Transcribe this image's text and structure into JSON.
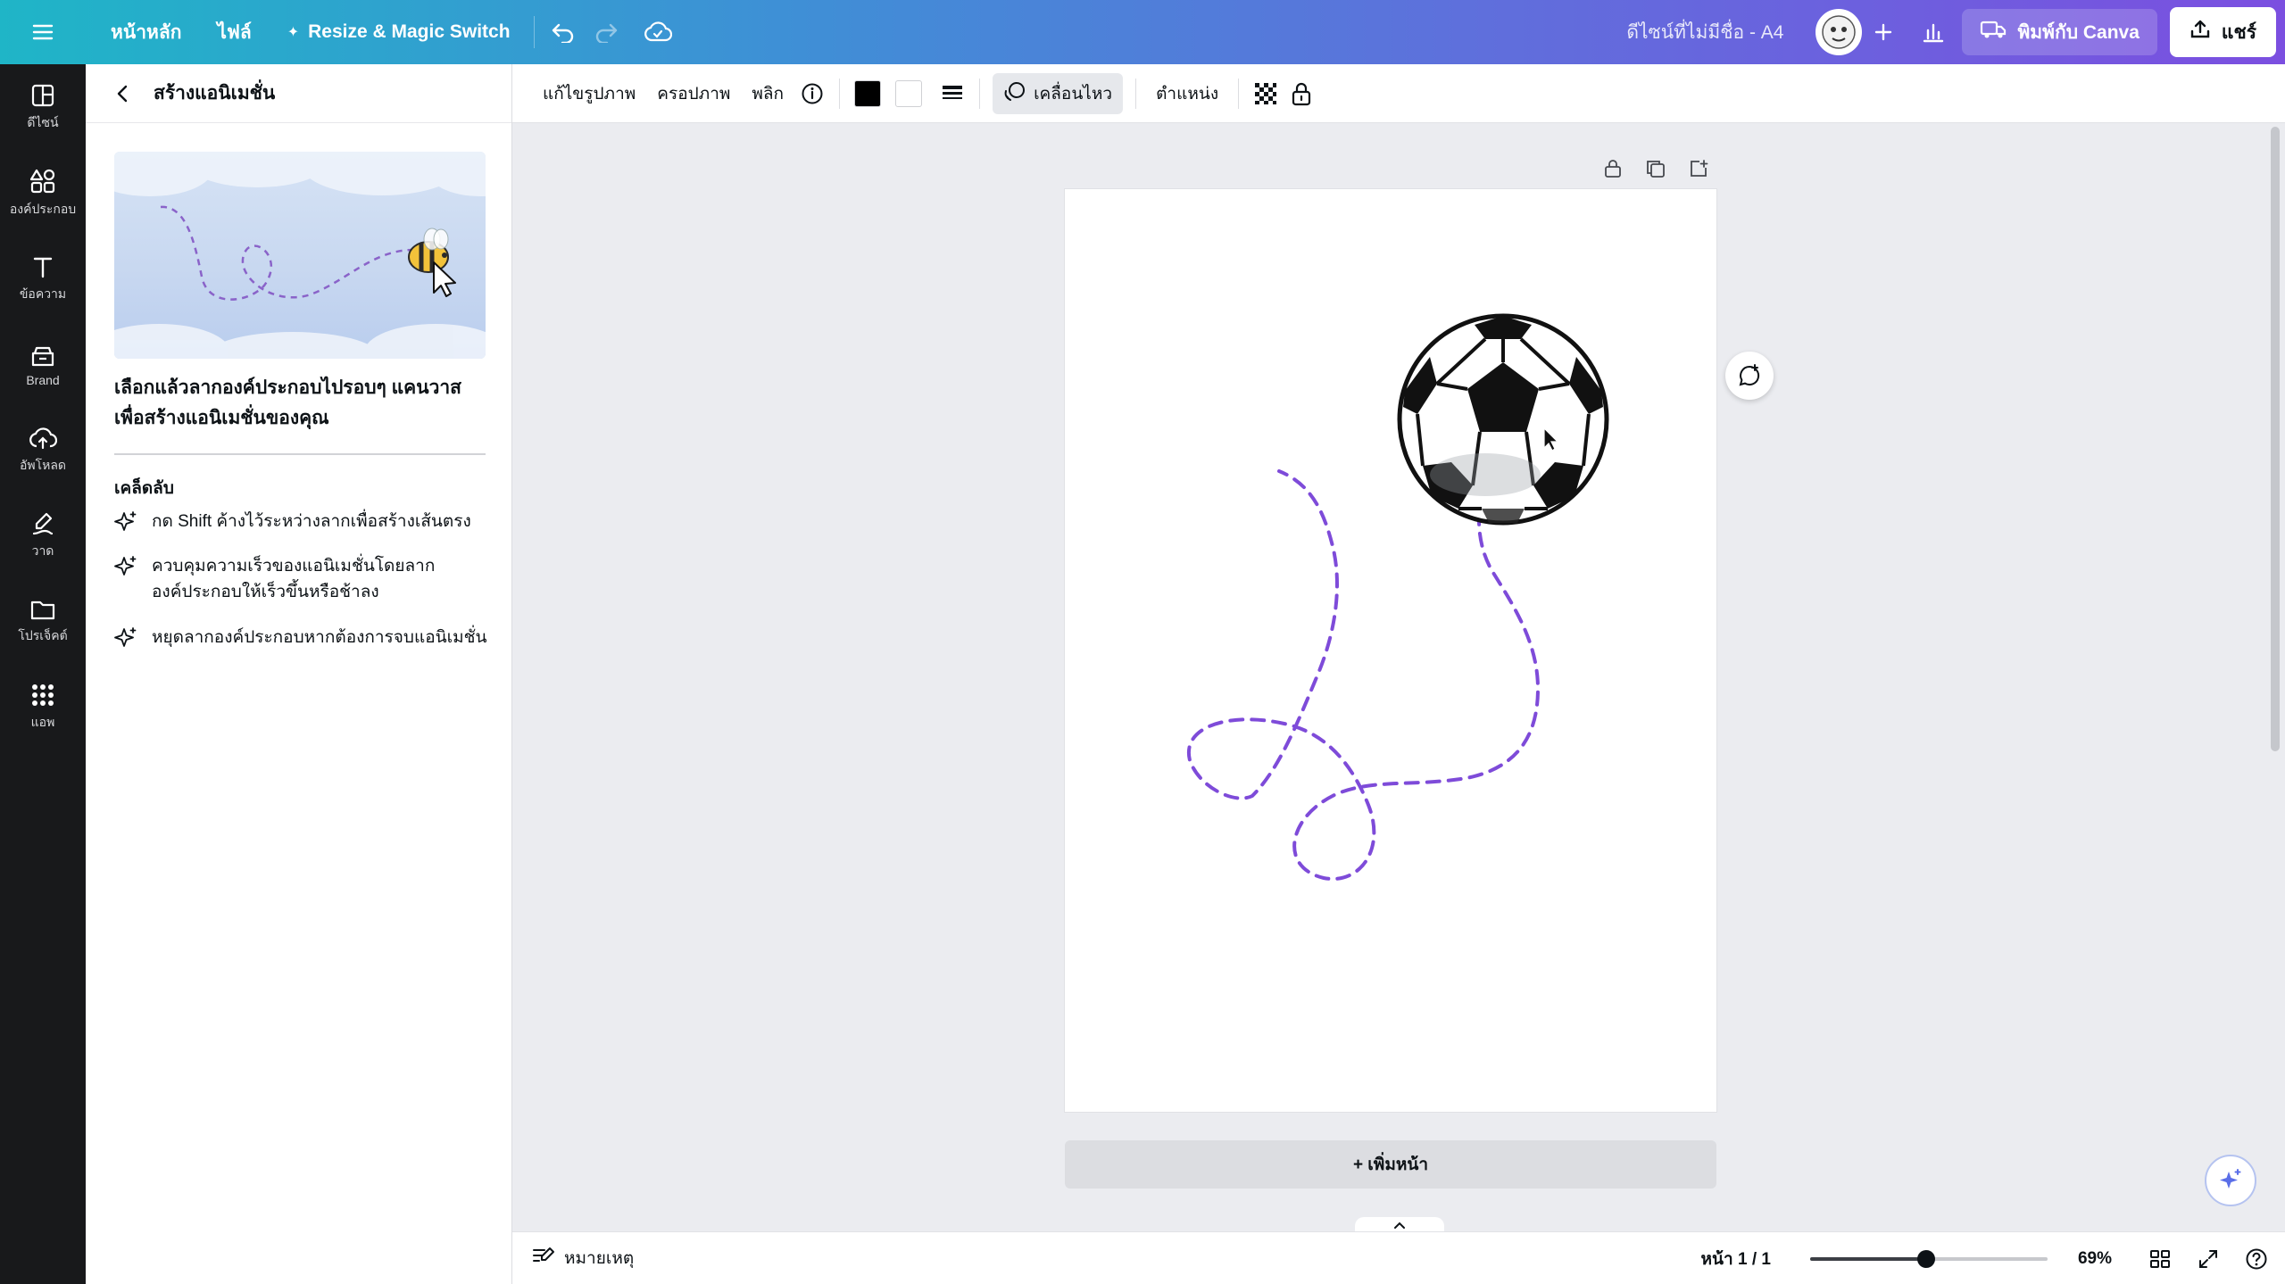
{
  "topbar": {
    "menu_icon": "hamburger-icon",
    "home": "หน้าหลัก",
    "file": "ไฟล์",
    "resize": "Resize & Magic Switch",
    "doc_title": "ดีไซน์ที่ไม่มีชื่อ - A4",
    "print": "พิมพ์กับ Canva",
    "share": "แชร์"
  },
  "rail": {
    "items": [
      {
        "label": "ดีไซน์",
        "icon": "layout-icon"
      },
      {
        "label": "องค์ประกอบ",
        "icon": "shapes-icon"
      },
      {
        "label": "ข้อความ",
        "icon": "text-icon"
      },
      {
        "label": "Brand",
        "icon": "brand-icon"
      },
      {
        "label": "อัพโหลด",
        "icon": "upload-icon"
      },
      {
        "label": "วาด",
        "icon": "draw-icon"
      },
      {
        "label": "โปรเจ็คต์",
        "icon": "folder-icon"
      },
      {
        "label": "แอพ",
        "icon": "apps-icon"
      }
    ]
  },
  "panel": {
    "title": "สร้างแอนิเมชั่น",
    "description": "เลือกแล้วลากองค์ประกอบไปรอบๆ แคนวาสเพื่อสร้างแอนิเมชั่นของคุณ",
    "tips_title": "เคล็ดลับ",
    "tips": [
      "กด Shift ค้างไว้ระหว่างลากเพื่อสร้างเส้นตรง",
      "ควบคุมความเร็วของแอนิเมชั่นโดยลากองค์ประกอบให้เร็วขึ้นหรือช้าลง",
      "หยุดลากองค์ประกอบหากต้องการจบแอนิเมชั่น"
    ]
  },
  "context_toolbar": {
    "edit_image": "แก้ไขรูปภาพ",
    "crop": "ครอปภาพ",
    "flip": "พลิก",
    "animate": "เคลื่อนไหว",
    "position": "ตำแหน่ง",
    "color_primary": "#000000",
    "color_secondary": "#ffffff"
  },
  "canvas": {
    "add_page": "+ เพิ่มหน้า",
    "path_color": "#7e4bd9"
  },
  "footer": {
    "notes": "หมายเหตุ",
    "page_info": "หน้า 1 / 1",
    "zoom": "69%",
    "zoom_level": 0.49
  }
}
